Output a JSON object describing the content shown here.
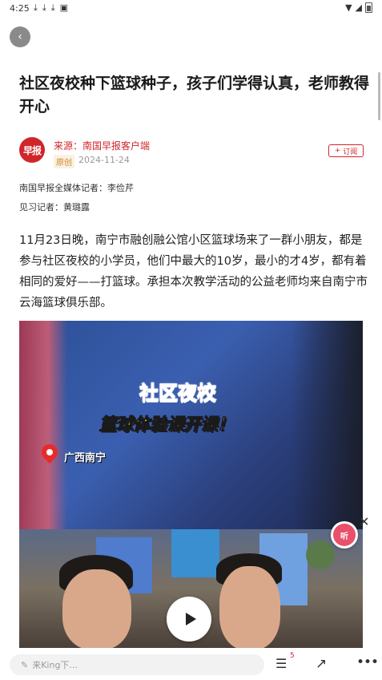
{
  "status_bar": {
    "time": "4:25",
    "left_icons": [
      "download-icon",
      "download-icon",
      "download-icon",
      "app-icon"
    ],
    "right_icons": [
      "wifi-icon",
      "signal-icon",
      "battery-icon"
    ]
  },
  "article": {
    "title": "社区夜校种下篮球种子，孩子们学得认真，老师教得开心",
    "source": {
      "logo_text": "早报",
      "name": "来源：南国早报客户端",
      "badge": "原创",
      "date": "2024-11-24",
      "subscribe_label": "订阅"
    },
    "bylines": [
      "南国早报全媒体记者：李俭芹",
      "见习记者：黄璐露"
    ],
    "body": "11月23日晚，南宁市融创融公馆小区篮球场来了一群小朋友，都是参与社区夜校的小学员，他们中最大的10岁，最小的才4岁，都有着相同的爱好——打篮球。承担本次教学活动的公益老师均来自南宁市云海篮球俱乐部。"
  },
  "video": {
    "overlay_title_1": "社区夜校",
    "overlay_title_2": "篮球体验课开课！",
    "location": "广西南宁"
  },
  "floating": {
    "listen_label": "听"
  },
  "bottom_bar": {
    "comment_placeholder": "来King下...",
    "comment_count": "5"
  },
  "colors": {
    "brand_red": "#d0262a",
    "badge_orange": "#c98a2a"
  }
}
